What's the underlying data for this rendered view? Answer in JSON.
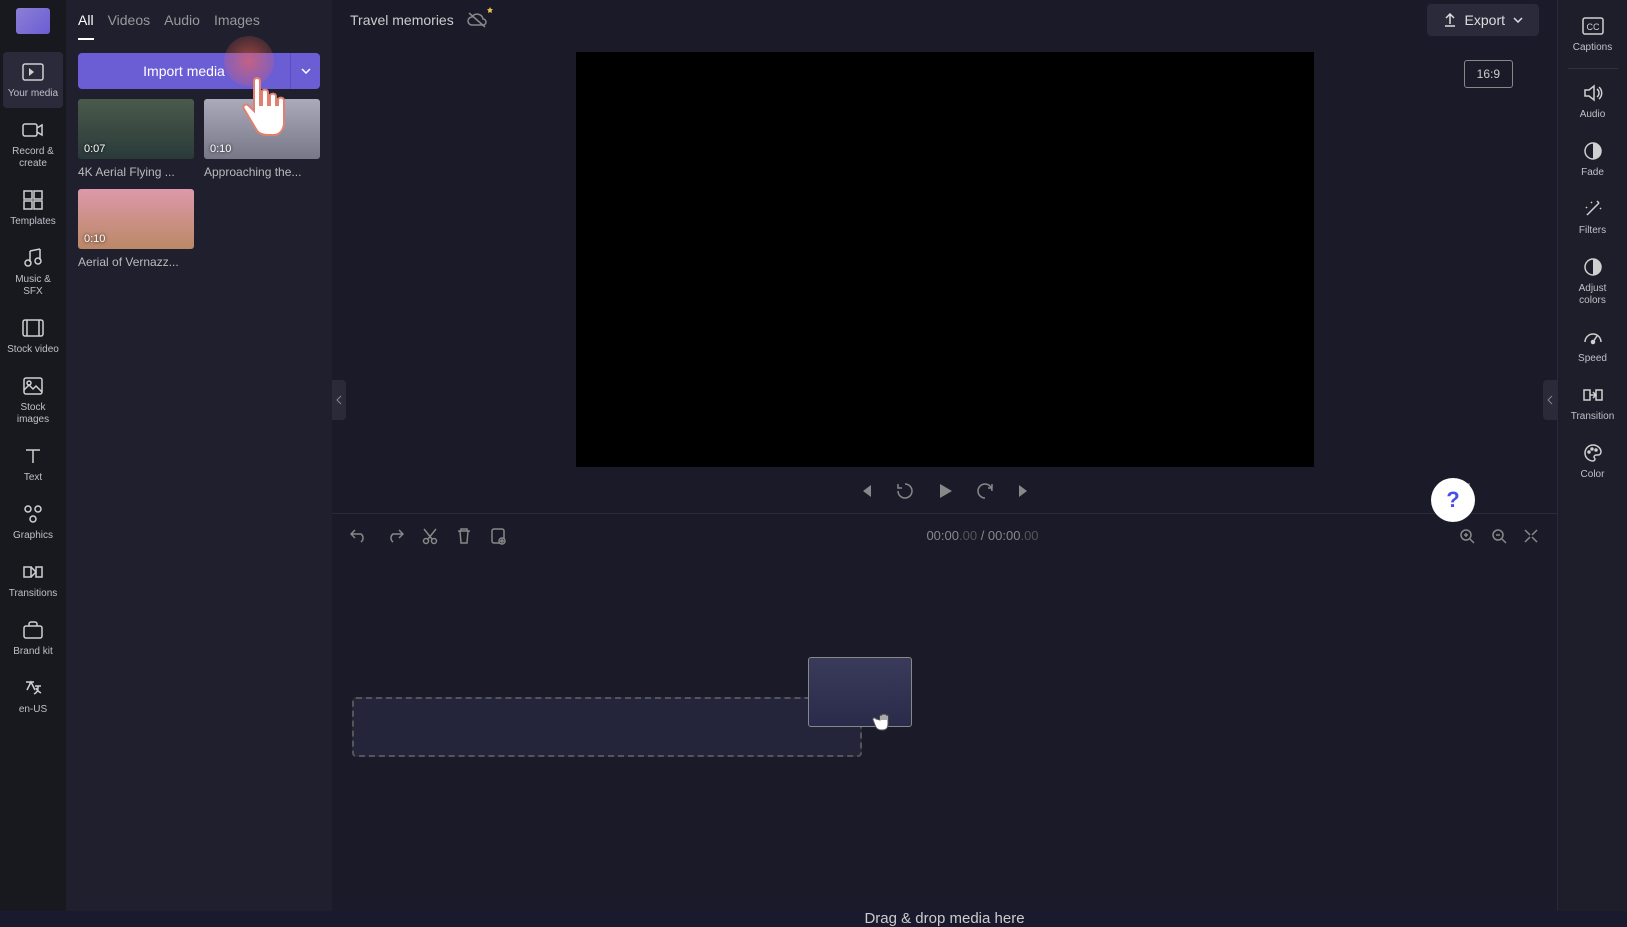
{
  "project_title": "Travel memories",
  "export_label": "Export",
  "aspect_ratio": "16:9",
  "left_nav": [
    {
      "label": "Your media"
    },
    {
      "label": "Record & create"
    },
    {
      "label": "Templates"
    },
    {
      "label": "Music & SFX"
    },
    {
      "label": "Stock video"
    },
    {
      "label": "Stock images"
    },
    {
      "label": "Text"
    },
    {
      "label": "Graphics"
    },
    {
      "label": "Transitions"
    },
    {
      "label": "Brand kit"
    },
    {
      "label": "en-US"
    }
  ],
  "media_tabs": [
    "All",
    "Videos",
    "Audio",
    "Images"
  ],
  "import_label": "Import media",
  "media_items": [
    {
      "duration": "0:07",
      "title": "4K Aerial Flying ..."
    },
    {
      "duration": "0:10",
      "title": "Approaching the..."
    },
    {
      "duration": "0:10",
      "title": "Aerial of Vernazz..."
    }
  ],
  "playback_time": {
    "current": "00:00",
    "current_ms": ".00",
    "sep": " / ",
    "total": "00:00",
    "total_ms": ".00"
  },
  "drop_text": "Drag & drop media here",
  "right_nav": [
    {
      "label": "Captions"
    },
    {
      "label": "Audio"
    },
    {
      "label": "Fade"
    },
    {
      "label": "Filters"
    },
    {
      "label": "Adjust colors"
    },
    {
      "label": "Speed"
    },
    {
      "label": "Transition"
    },
    {
      "label": "Color"
    }
  ]
}
